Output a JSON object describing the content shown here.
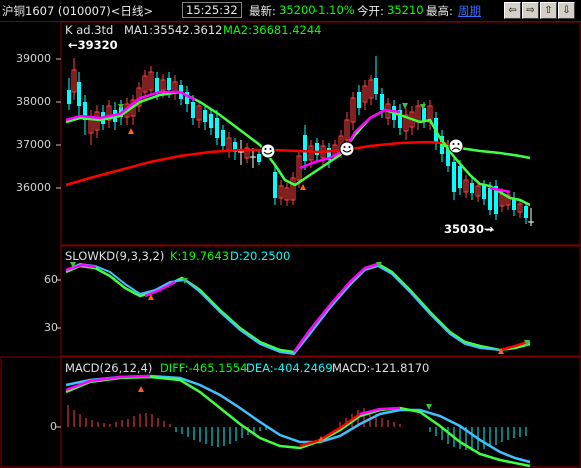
{
  "header": {
    "title": "沪铜1607 (010007)<日线>",
    "clock": "15:25:32",
    "latest_label": "最新:",
    "latest_value": "35200",
    "change": "-1.10%",
    "open_label": "今开:",
    "open_value": "35210",
    "high_label": "最高:",
    "period_link": "周期",
    "nav_buttons": [
      "⇦",
      "⇨",
      "⇧",
      "⇩"
    ]
  },
  "colors": {
    "up": "#ff4040",
    "down": "#00ffff",
    "ma_red": "#ff0000",
    "ma_green": "#40ff40",
    "kd_k": "#ff00ff",
    "kd_d": "#ffffff",
    "frame": "#800000"
  },
  "main_panel": {
    "legend_k": "K  ad.3td",
    "legend_ma1": "MA1:35542.3612",
    "legend_ma2": "MA2:36681.4244",
    "high_marker": "←39320",
    "low_marker": "35030→",
    "y_ticks": [
      "39000",
      "38000",
      "37000",
      "36000"
    ]
  },
  "kd_panel": {
    "title": "SLOWKD(9,3,3,2)",
    "k_label": "K:19.7643",
    "d_label": "D:20.2500",
    "y_ticks": [
      "60",
      "30"
    ]
  },
  "macd_panel": {
    "title": "MACD(26,12,4)",
    "diff_label": "DIFF:-465.1554",
    "dea_label": "DEA:-404.2469",
    "macd_label": "MACD:-121.8170",
    "y_ticks": [
      "0"
    ]
  }
}
